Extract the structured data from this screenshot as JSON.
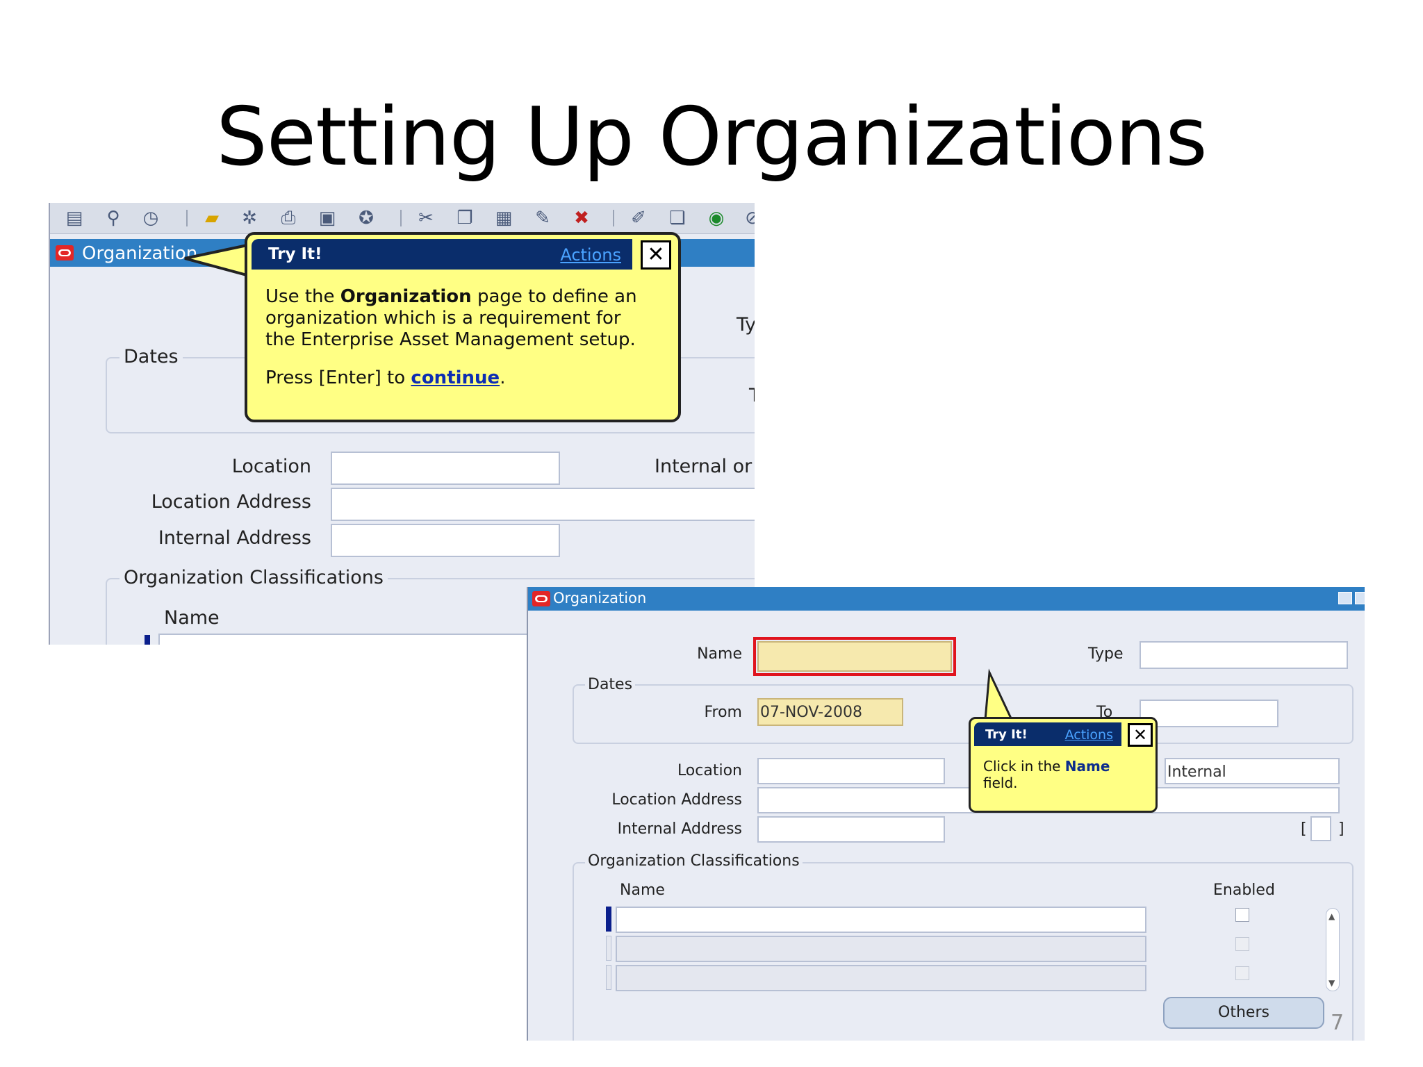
{
  "slide": {
    "title": "Setting Up Organizations",
    "page_number": "7"
  },
  "shot1": {
    "window_title": "Organization",
    "labels": {
      "type_partial": "Ty",
      "to_partial": "T",
      "dates": "Dates",
      "location": "Location",
      "location_address": "Location Address",
      "internal_address": "Internal Address",
      "internal_external_partial": "Internal or E",
      "classifications": "Organization Classifications",
      "name": "Name"
    },
    "tryit": {
      "header": "Try It!",
      "actions": "Actions",
      "close": "X",
      "line1_pre": "Use the ",
      "line1_bold": "Organization",
      "line1_post": " page to define an",
      "line2": "organization which is a requirement for",
      "line3": "the Enterprise Asset Management setup.",
      "press_pre": "Press [Enter] to ",
      "press_link": "continue",
      "press_post": "."
    },
    "toolbar_icons": [
      "new-record-icon",
      "find-icon",
      "navigator-icon",
      "save-icon",
      "next-step-icon",
      "print-icon",
      "close-form-icon",
      "attachments-icon",
      "cut-icon",
      "copy-icon",
      "paste-icon",
      "clear-record-icon",
      "delete-record-icon",
      "edit-field-icon",
      "zoom-icon",
      "translations-icon",
      "folder-tools-icon"
    ]
  },
  "shot2": {
    "window_title": "Organization",
    "labels": {
      "name": "Name",
      "type": "Type",
      "dates": "Dates",
      "from": "From",
      "to_partial": "To",
      "location": "Location",
      "location_address": "Location Address",
      "internal_address": "Internal Address",
      "bracket_open": "[",
      "bracket_close": "]",
      "classifications": "Organization Classifications",
      "class_name": "Name",
      "enabled": "Enabled"
    },
    "values": {
      "from_date": "07-NOV-2008",
      "internal_external": "Internal"
    },
    "buttons": {
      "others": "Others"
    },
    "tryit": {
      "header": "Try It!",
      "actions": "Actions",
      "close": "X",
      "text_pre": "Click in the ",
      "text_bold": "Name",
      "text_post": "field."
    }
  }
}
